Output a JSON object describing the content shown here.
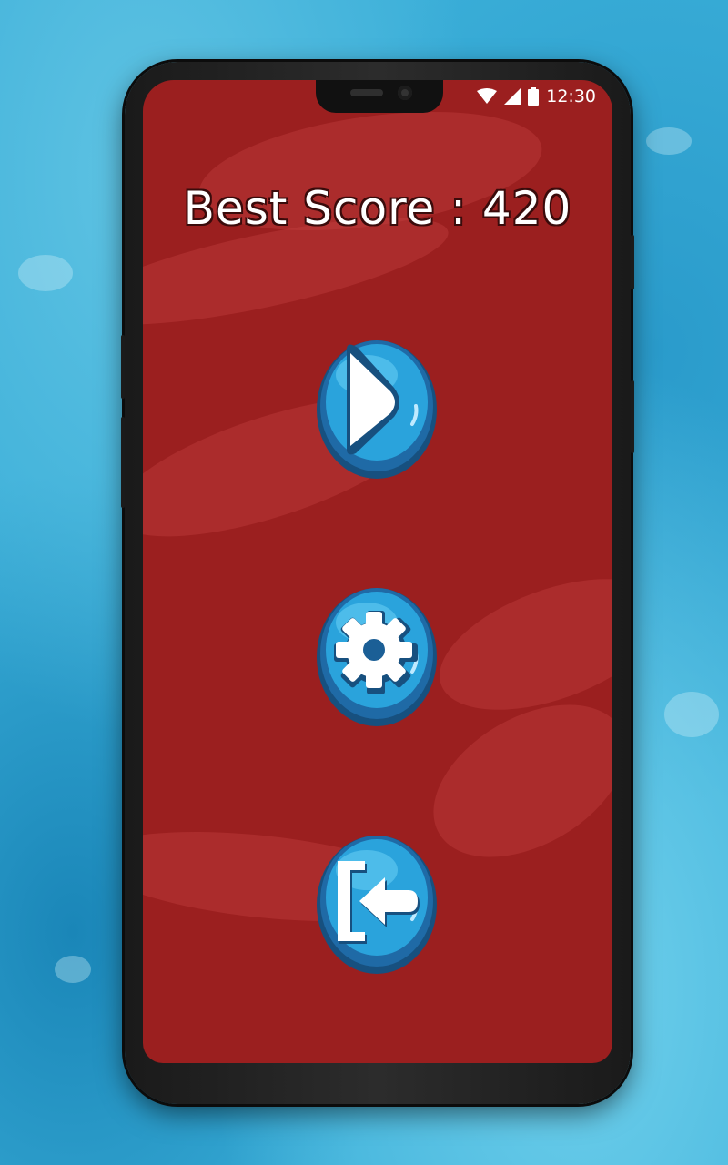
{
  "status_bar": {
    "time": "12:30",
    "icons": [
      "wifi-icon",
      "signal-icon",
      "battery-icon"
    ]
  },
  "menu": {
    "best_score_label": "Best Score : 420",
    "buttons": [
      {
        "name": "play-button",
        "icon": "play-icon"
      },
      {
        "name": "settings-button",
        "icon": "gear-icon"
      },
      {
        "name": "exit-button",
        "icon": "exit-icon"
      }
    ]
  },
  "colors": {
    "screen_background": "#9b1f1f",
    "button_blue": "#2aa3dc",
    "button_rim": "#1b5f96",
    "page_background": "#3aaed8"
  }
}
